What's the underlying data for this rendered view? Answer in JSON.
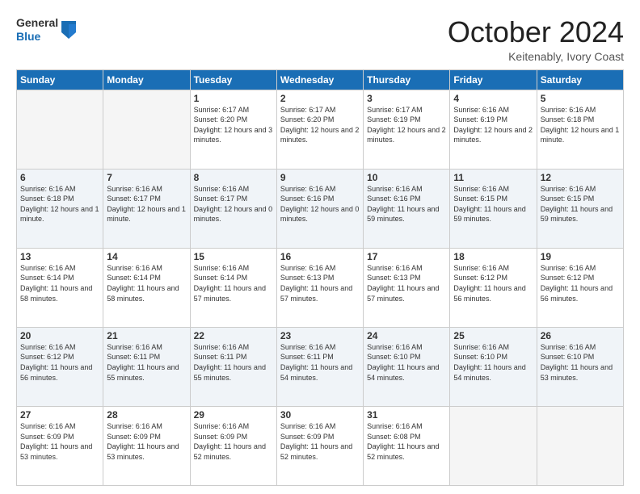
{
  "header": {
    "logo": {
      "general": "General",
      "blue": "Blue"
    },
    "title": "October 2024",
    "location": "Keitenably, Ivory Coast"
  },
  "days_of_week": [
    "Sunday",
    "Monday",
    "Tuesday",
    "Wednesday",
    "Thursday",
    "Friday",
    "Saturday"
  ],
  "weeks": [
    [
      {
        "day": "",
        "info": ""
      },
      {
        "day": "",
        "info": ""
      },
      {
        "day": "1",
        "info": "Sunrise: 6:17 AM\nSunset: 6:20 PM\nDaylight: 12 hours and 3 minutes."
      },
      {
        "day": "2",
        "info": "Sunrise: 6:17 AM\nSunset: 6:20 PM\nDaylight: 12 hours and 2 minutes."
      },
      {
        "day": "3",
        "info": "Sunrise: 6:17 AM\nSunset: 6:19 PM\nDaylight: 12 hours and 2 minutes."
      },
      {
        "day": "4",
        "info": "Sunrise: 6:16 AM\nSunset: 6:19 PM\nDaylight: 12 hours and 2 minutes."
      },
      {
        "day": "5",
        "info": "Sunrise: 6:16 AM\nSunset: 6:18 PM\nDaylight: 12 hours and 1 minute."
      }
    ],
    [
      {
        "day": "6",
        "info": "Sunrise: 6:16 AM\nSunset: 6:18 PM\nDaylight: 12 hours and 1 minute."
      },
      {
        "day": "7",
        "info": "Sunrise: 6:16 AM\nSunset: 6:17 PM\nDaylight: 12 hours and 1 minute."
      },
      {
        "day": "8",
        "info": "Sunrise: 6:16 AM\nSunset: 6:17 PM\nDaylight: 12 hours and 0 minutes."
      },
      {
        "day": "9",
        "info": "Sunrise: 6:16 AM\nSunset: 6:16 PM\nDaylight: 12 hours and 0 minutes."
      },
      {
        "day": "10",
        "info": "Sunrise: 6:16 AM\nSunset: 6:16 PM\nDaylight: 11 hours and 59 minutes."
      },
      {
        "day": "11",
        "info": "Sunrise: 6:16 AM\nSunset: 6:15 PM\nDaylight: 11 hours and 59 minutes."
      },
      {
        "day": "12",
        "info": "Sunrise: 6:16 AM\nSunset: 6:15 PM\nDaylight: 11 hours and 59 minutes."
      }
    ],
    [
      {
        "day": "13",
        "info": "Sunrise: 6:16 AM\nSunset: 6:14 PM\nDaylight: 11 hours and 58 minutes."
      },
      {
        "day": "14",
        "info": "Sunrise: 6:16 AM\nSunset: 6:14 PM\nDaylight: 11 hours and 58 minutes."
      },
      {
        "day": "15",
        "info": "Sunrise: 6:16 AM\nSunset: 6:14 PM\nDaylight: 11 hours and 57 minutes."
      },
      {
        "day": "16",
        "info": "Sunrise: 6:16 AM\nSunset: 6:13 PM\nDaylight: 11 hours and 57 minutes."
      },
      {
        "day": "17",
        "info": "Sunrise: 6:16 AM\nSunset: 6:13 PM\nDaylight: 11 hours and 57 minutes."
      },
      {
        "day": "18",
        "info": "Sunrise: 6:16 AM\nSunset: 6:12 PM\nDaylight: 11 hours and 56 minutes."
      },
      {
        "day": "19",
        "info": "Sunrise: 6:16 AM\nSunset: 6:12 PM\nDaylight: 11 hours and 56 minutes."
      }
    ],
    [
      {
        "day": "20",
        "info": "Sunrise: 6:16 AM\nSunset: 6:12 PM\nDaylight: 11 hours and 56 minutes."
      },
      {
        "day": "21",
        "info": "Sunrise: 6:16 AM\nSunset: 6:11 PM\nDaylight: 11 hours and 55 minutes."
      },
      {
        "day": "22",
        "info": "Sunrise: 6:16 AM\nSunset: 6:11 PM\nDaylight: 11 hours and 55 minutes."
      },
      {
        "day": "23",
        "info": "Sunrise: 6:16 AM\nSunset: 6:11 PM\nDaylight: 11 hours and 54 minutes."
      },
      {
        "day": "24",
        "info": "Sunrise: 6:16 AM\nSunset: 6:10 PM\nDaylight: 11 hours and 54 minutes."
      },
      {
        "day": "25",
        "info": "Sunrise: 6:16 AM\nSunset: 6:10 PM\nDaylight: 11 hours and 54 minutes."
      },
      {
        "day": "26",
        "info": "Sunrise: 6:16 AM\nSunset: 6:10 PM\nDaylight: 11 hours and 53 minutes."
      }
    ],
    [
      {
        "day": "27",
        "info": "Sunrise: 6:16 AM\nSunset: 6:09 PM\nDaylight: 11 hours and 53 minutes."
      },
      {
        "day": "28",
        "info": "Sunrise: 6:16 AM\nSunset: 6:09 PM\nDaylight: 11 hours and 53 minutes."
      },
      {
        "day": "29",
        "info": "Sunrise: 6:16 AM\nSunset: 6:09 PM\nDaylight: 11 hours and 52 minutes."
      },
      {
        "day": "30",
        "info": "Sunrise: 6:16 AM\nSunset: 6:09 PM\nDaylight: 11 hours and 52 minutes."
      },
      {
        "day": "31",
        "info": "Sunrise: 6:16 AM\nSunset: 6:08 PM\nDaylight: 11 hours and 52 minutes."
      },
      {
        "day": "",
        "info": ""
      },
      {
        "day": "",
        "info": ""
      }
    ]
  ]
}
